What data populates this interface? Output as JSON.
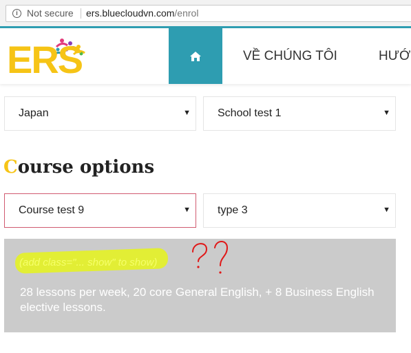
{
  "browser": {
    "security_label": "Not secure",
    "url_host": "ers.bluecloudvn.com",
    "url_path": "/enrol"
  },
  "header": {
    "logo_text": "ERS",
    "home_icon": "home-icon",
    "nav": [
      "VỀ CHÚNG TÔI",
      "HƯỚ"
    ]
  },
  "form": {
    "country": "Japan",
    "school": "School test 1",
    "section_title_first": "C",
    "section_title_rest": "ourse options",
    "course": "Course test 9",
    "type": "type 3"
  },
  "info": {
    "hint": "(add class=\"... show\" to show)",
    "annotation": "??",
    "description": "28 lessons per week, 20 core General English, + 8 Business English elective lessons."
  },
  "colors": {
    "accent_teal": "#2e9db1",
    "logo_yellow": "#f6c416",
    "info_bg": "#cbcbcb",
    "annotation_red": "#e01818"
  }
}
